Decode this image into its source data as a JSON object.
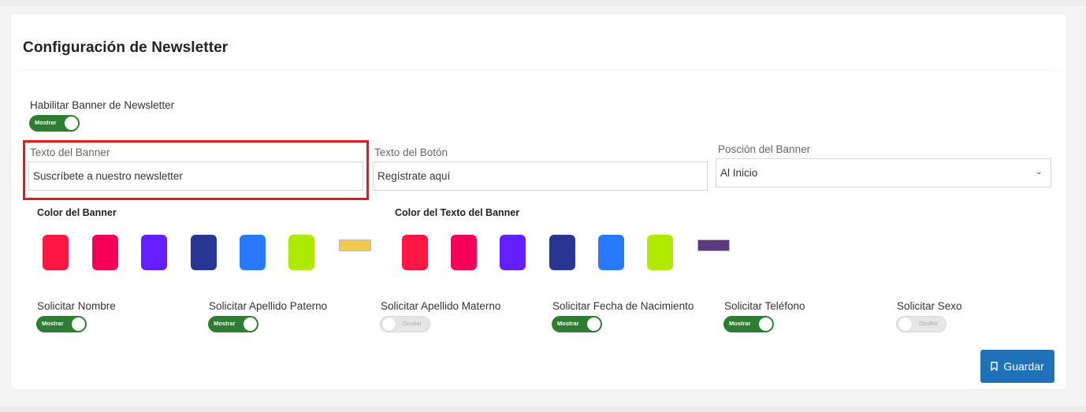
{
  "card": {
    "title": "Configuración de Newsletter"
  },
  "enable_banner": {
    "label": "Habilitar Banner de Newsletter",
    "toggle_text": "Mostrar",
    "on": true
  },
  "fields": {
    "banner_text": {
      "label": "Texto del Banner",
      "value": "Suscríbete a nuestro newsletter"
    },
    "button_text": {
      "label": "Texto del Botón",
      "value": "Regístrate aquí"
    },
    "banner_position": {
      "label": "Posción del Banner",
      "value": "Al Inicio"
    }
  },
  "colors": {
    "banner": {
      "label": "Color del Banner",
      "swatches": [
        "#ff1744",
        "#f50057",
        "#651fff",
        "#283593",
        "#2979ff",
        "#aeea00"
      ],
      "selected": "#f2c94c"
    },
    "banner_text": {
      "label": "Color del Texto del Banner",
      "swatches": [
        "#ff1744",
        "#f50057",
        "#651fff",
        "#283593",
        "#2979ff",
        "#aeea00"
      ],
      "selected": "#5b3a7e"
    }
  },
  "requests": [
    {
      "label": "Solicitar Nombre",
      "toggle_text": "Mostrar",
      "on": true
    },
    {
      "label": "Solicitar Apellido Paterno",
      "toggle_text": "Mostrar",
      "on": true
    },
    {
      "label": "Solicitar Apellido Materno",
      "toggle_text": "Ocultar",
      "on": false
    },
    {
      "label": "Solicitar Fecha de Nacimiento",
      "toggle_text": "Mostrar",
      "on": true
    },
    {
      "label": "Solicitar Teléfono",
      "toggle_text": "Mostrar",
      "on": true
    },
    {
      "label": "Solicitar Sexo",
      "toggle_text": "Ocultar",
      "on": false
    }
  ],
  "save_button": {
    "label": "Guardar",
    "icon": "bookmark-icon"
  }
}
